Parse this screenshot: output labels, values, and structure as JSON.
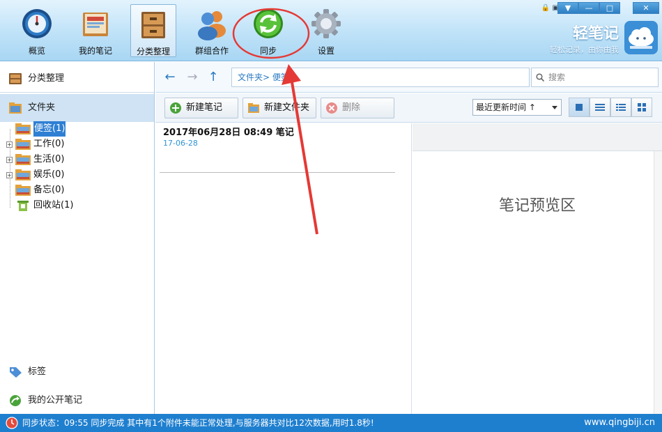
{
  "toolbar": {
    "items": [
      {
        "label": "概览",
        "icon": "dashboard-icon"
      },
      {
        "label": "我的笔记",
        "icon": "notebook-icon"
      },
      {
        "label": "分类整理",
        "icon": "cabinet-icon"
      },
      {
        "label": "群组合作",
        "icon": "group-icon"
      },
      {
        "label": "同步",
        "icon": "sync-icon"
      },
      {
        "label": "设置",
        "icon": "gear-icon"
      }
    ],
    "active": "分类整理",
    "highlighted": "同步"
  },
  "brand": {
    "name": "轻笔记",
    "slogan": "轻松记录，由你由我"
  },
  "window_controls": {
    "menu": "▼",
    "minimize": "—",
    "maximize": "□",
    "close": "✕"
  },
  "left": {
    "header": "分类整理",
    "section": "文件夹",
    "tree": [
      {
        "label": "便签(1)",
        "selected": true,
        "expandable": false
      },
      {
        "label": "工作(0)",
        "selected": false,
        "expandable": true
      },
      {
        "label": "生活(0)",
        "selected": false,
        "expandable": true
      },
      {
        "label": "娱乐(0)",
        "selected": false,
        "expandable": true
      },
      {
        "label": "备忘(0)",
        "selected": false,
        "expandable": false
      },
      {
        "label": "回收站(1)",
        "selected": false,
        "expandable": false
      }
    ],
    "tags": "标签",
    "public_notes": "我的公开笔记"
  },
  "nav": {
    "breadcrumb": "文件夹>  便签",
    "search_placeholder": "搜索"
  },
  "actions": {
    "new_note": "新建笔记",
    "new_folder": "新建文件夹",
    "delete": "删除",
    "sort": "最近更新时间 ↑"
  },
  "notes": [
    {
      "title": "2017年06月28日 08:49 笔记",
      "date": "17-06-28"
    }
  ],
  "preview": {
    "placeholder": "笔记预览区"
  },
  "status": {
    "text": "同步状态：09:55 同步完成 其中有1个附件未能正常处理,与服务器共对比12次数据,用时1.8秒!",
    "url": "www.qingbiji.cn"
  },
  "colors": {
    "accent": "#1f7fcf",
    "annotation": "#e53935",
    "selection": "#2e7fd3"
  }
}
